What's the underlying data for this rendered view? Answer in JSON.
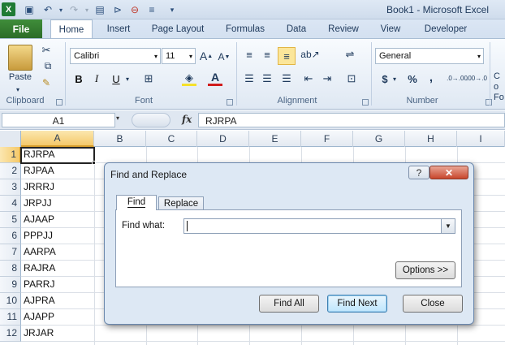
{
  "window": {
    "title": "Book1  -  Microsoft Excel"
  },
  "quick_access": [
    "excel-logo-icon",
    "save-icon",
    "undo-icon",
    "redo-icon",
    "form-icon",
    "macro-icon",
    "delete-icon",
    "align-icon",
    "customize-icon"
  ],
  "tabs": {
    "file": "File",
    "items": [
      "Home",
      "Insert",
      "Page Layout",
      "Formulas",
      "Data",
      "Review",
      "View",
      "Developer"
    ]
  },
  "ribbon": {
    "clipboard": {
      "label": "Clipboard",
      "paste": "Paste"
    },
    "font": {
      "label": "Font",
      "name": "Calibri",
      "size": "11",
      "bold": "B",
      "italic": "I",
      "underline": "U",
      "grow": "A",
      "shrink": "A",
      "color_a": "A"
    },
    "alignment": {
      "label": "Alignment"
    },
    "number": {
      "label": "Number",
      "format": "General",
      "currency": "$",
      "percent": "%",
      "comma": ",",
      "inc": ".0→.00",
      "dec": ".00→.0"
    },
    "styles_cut": "Co Fo"
  },
  "formula_bar": {
    "name_box": "A1",
    "fx": "fx",
    "value": "RJRPA"
  },
  "columns": [
    "A",
    "B",
    "C",
    "D",
    "E",
    "F",
    "G",
    "H",
    "I"
  ],
  "rows": [
    {
      "n": "1",
      "a": "RJRPA"
    },
    {
      "n": "2",
      "a": "RJPAA"
    },
    {
      "n": "3",
      "a": "JRRRJ"
    },
    {
      "n": "4",
      "a": "JRPJJ"
    },
    {
      "n": "5",
      "a": "AJAAP"
    },
    {
      "n": "6",
      "a": "PPPJJ"
    },
    {
      "n": "7",
      "a": "AARPA"
    },
    {
      "n": "8",
      "a": "RAJRA"
    },
    {
      "n": "9",
      "a": "PARRJ"
    },
    {
      "n": "10",
      "a": "AJPRA"
    },
    {
      "n": "11",
      "a": "AJAPP"
    },
    {
      "n": "12",
      "a": "JRJAR"
    }
  ],
  "dialog": {
    "title": "Find and Replace",
    "help": "?",
    "close": "✕",
    "tab_find": "Find",
    "tab_replace": "Replace",
    "find_label": "Find what:",
    "find_value": "",
    "options": "Options >>",
    "find_all": "Find All",
    "find_next": "Find Next",
    "close_btn": "Close"
  }
}
